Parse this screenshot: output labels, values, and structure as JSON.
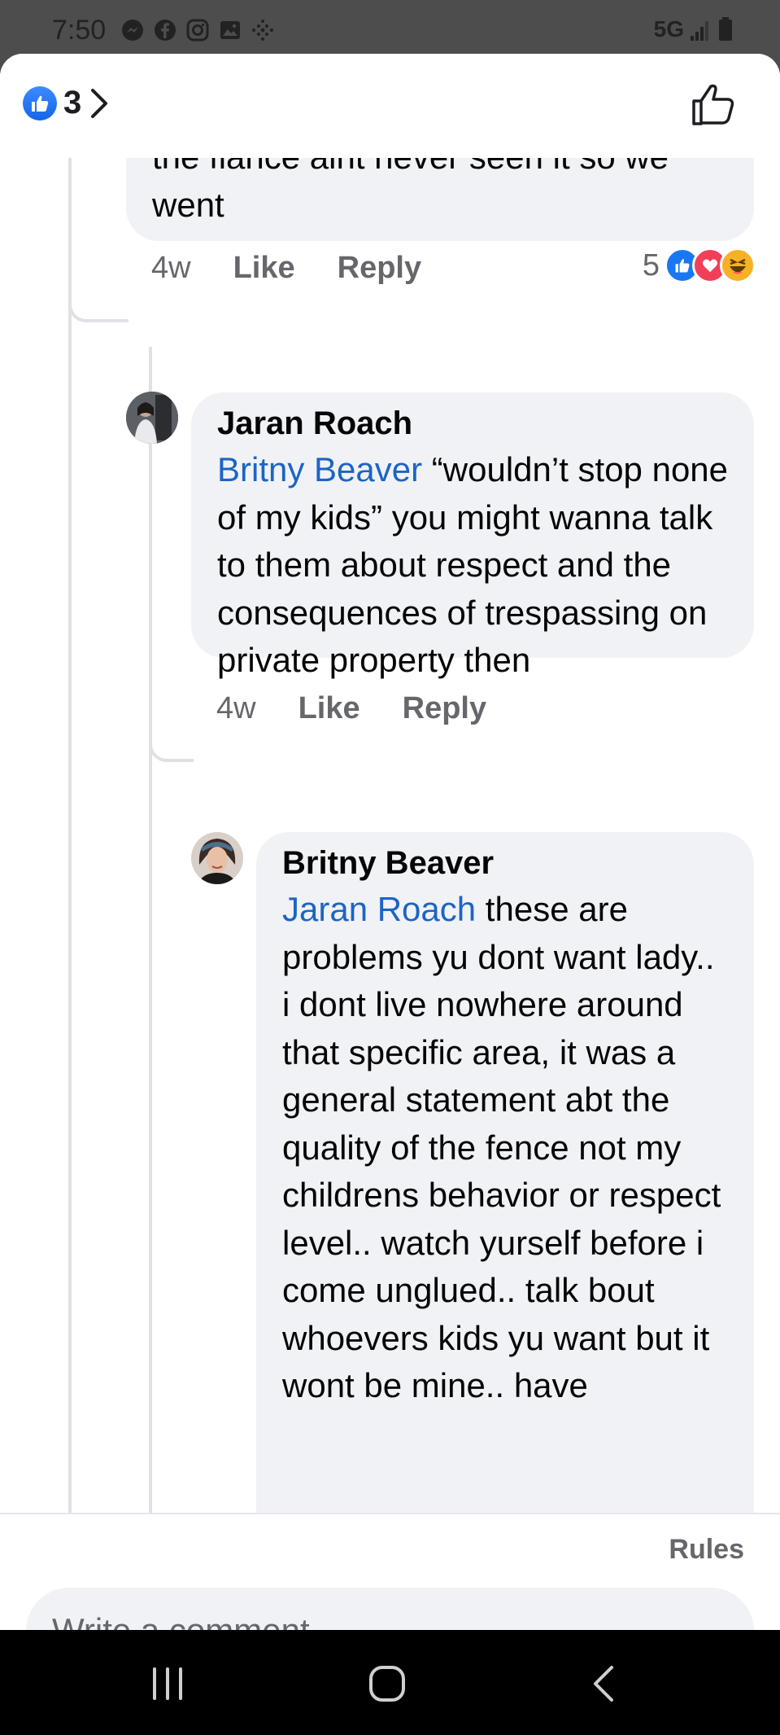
{
  "status_bar": {
    "time": "7:50",
    "network": "5G",
    "icons": [
      "messenger-icon",
      "facebook-icon",
      "instagram-icon",
      "gallery-icon",
      "dots-icon"
    ]
  },
  "header": {
    "reaction_icon": "like-icon",
    "reaction_count": "3"
  },
  "comments": [
    {
      "text": "the fiance aint never seen it so we went",
      "time": "4w",
      "like_label": "Like",
      "reply_label": "Reply",
      "reaction_count": "5",
      "reactions": [
        "like",
        "love",
        "haha"
      ]
    },
    {
      "author": "Jaran Roach",
      "mention": "Britny Beaver",
      "text": " “wouldn’t stop none of my kids” you might wanna talk to them about respect and the consequences of trespassing on private property then",
      "time": "4w",
      "like_label": "Like",
      "reply_label": "Reply"
    },
    {
      "author": "Britny Beaver",
      "mention": "Jaran Roach",
      "text": " these are problems yu dont want lady.. i dont live nowhere around that specific area, it was a general statement abt the quality of the fence not my childrens behavior or respect level.. watch yurself before i come unglued.. talk bout whoevers kids yu want but it wont be mine.. have"
    }
  ],
  "footer": {
    "rules_label": "Rules",
    "comment_placeholder": "Write a comment…"
  },
  "colors": {
    "accent": "#1877f2",
    "mention": "#1d64c5",
    "bubble": "#f0f2f5",
    "meta": "#65676b"
  }
}
